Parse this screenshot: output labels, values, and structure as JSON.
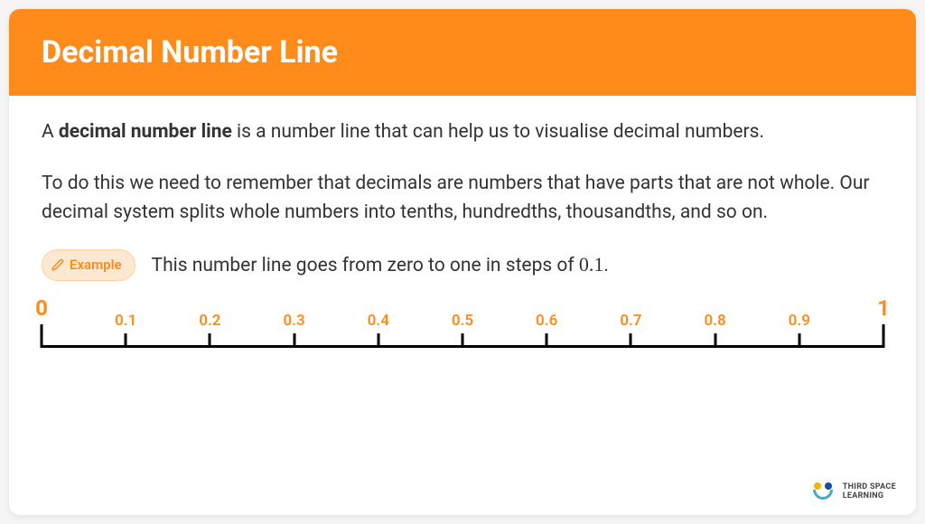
{
  "header": {
    "title": "Decimal Number Line"
  },
  "body": {
    "intro_prefix": "A ",
    "intro_bold": "decimal number line",
    "intro_suffix": " is a number line that can help us to visualise decimal numbers.",
    "para2": "To do this we need to remember that decimals are numbers that have parts that are not whole. Our decimal system splits whole numbers into tenths, hundredths, thousandths, and so on."
  },
  "example": {
    "badge": "Example",
    "text_prefix": "This number line goes from zero to one in steps of ",
    "text_value": "0.1",
    "text_suffix": "."
  },
  "chart_data": {
    "type": "numberline",
    "range": [
      0,
      1
    ],
    "step": 0.1,
    "major_ticks": [
      {
        "value": 0,
        "label": "0",
        "pos_pct": 0
      },
      {
        "value": 1,
        "label": "1",
        "pos_pct": 100
      }
    ],
    "minor_ticks": [
      {
        "value": 0.1,
        "label": "0.1",
        "pos_pct": 10
      },
      {
        "value": 0.2,
        "label": "0.2",
        "pos_pct": 20
      },
      {
        "value": 0.3,
        "label": "0.3",
        "pos_pct": 30
      },
      {
        "value": 0.4,
        "label": "0.4",
        "pos_pct": 40
      },
      {
        "value": 0.5,
        "label": "0.5",
        "pos_pct": 50
      },
      {
        "value": 0.6,
        "label": "0.6",
        "pos_pct": 60
      },
      {
        "value": 0.7,
        "label": "0.7",
        "pos_pct": 70
      },
      {
        "value": 0.8,
        "label": "0.8",
        "pos_pct": 80
      },
      {
        "value": 0.9,
        "label": "0.9",
        "pos_pct": 90
      }
    ]
  },
  "logo": {
    "line1": "THIRD SPACE",
    "line2": "LEARNING"
  }
}
